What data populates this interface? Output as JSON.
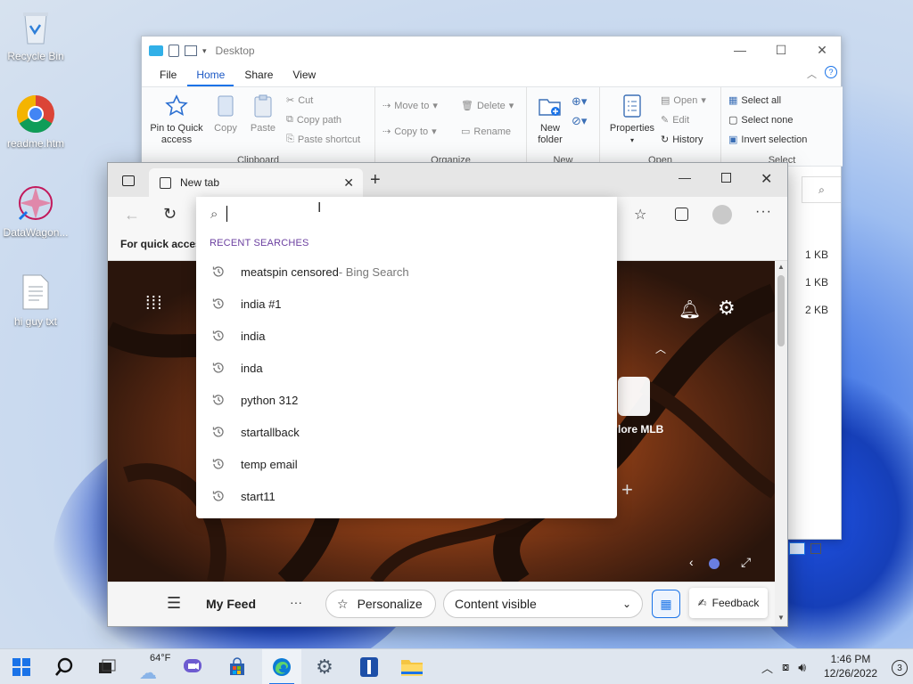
{
  "desktop": {
    "icons": [
      {
        "label": "Recycle Bin"
      },
      {
        "label": "readme.htm"
      },
      {
        "label": "DataWagon..."
      },
      {
        "label": "hi guy txt"
      }
    ]
  },
  "explorer": {
    "title": "Desktop",
    "tabs": [
      "File",
      "Home",
      "Share",
      "View"
    ],
    "active_tab": "Home",
    "ribbon": {
      "clipboard": {
        "name": "Clipboard",
        "pin": "Pin to Quick access",
        "copy": "Copy",
        "paste": "Paste",
        "cut": "Cut",
        "copy_path": "Copy path",
        "paste_shortcut": "Paste shortcut"
      },
      "organize": {
        "name": "Organize",
        "move_to": "Move to",
        "copy_to": "Copy to",
        "delete": "Delete",
        "rename": "Rename"
      },
      "new": {
        "name": "New",
        "new_folder": "New folder"
      },
      "open": {
        "name": "Open",
        "properties": "Properties",
        "open": "Open",
        "edit": "Edit",
        "history": "History"
      },
      "select": {
        "name": "Select",
        "select_all": "Select all",
        "select_none": "Select none",
        "invert": "Invert selection"
      }
    },
    "file_sizes": [
      "1 KB",
      "1 KB",
      "2 KB"
    ]
  },
  "edge": {
    "tab_title": "New tab",
    "favorites_bar_text": "For quick access",
    "tile_label": "lore MLB",
    "bottom": {
      "feed_title": "My Feed",
      "personalize": "Personalize",
      "content_visible": "Content visible",
      "feedback": "Feedback"
    }
  },
  "search_dropdown": {
    "input_value": "",
    "section_header": "RECENT SEARCHES",
    "items": [
      {
        "text": "meatspin censored",
        "suffix": " - Bing Search"
      },
      {
        "text": "india #1",
        "suffix": ""
      },
      {
        "text": "india",
        "suffix": ""
      },
      {
        "text": "inda",
        "suffix": ""
      },
      {
        "text": "python 312",
        "suffix": ""
      },
      {
        "text": "startallback",
        "suffix": ""
      },
      {
        "text": "temp email",
        "suffix": ""
      },
      {
        "text": "start11",
        "suffix": ""
      }
    ]
  },
  "taskbar": {
    "weather": "64°F",
    "time": "1:46 PM",
    "date": "12/26/2022",
    "notification_count": "3"
  },
  "colors": {
    "accent": "#1a73e8",
    "recent_header": "#6b3fa0"
  }
}
